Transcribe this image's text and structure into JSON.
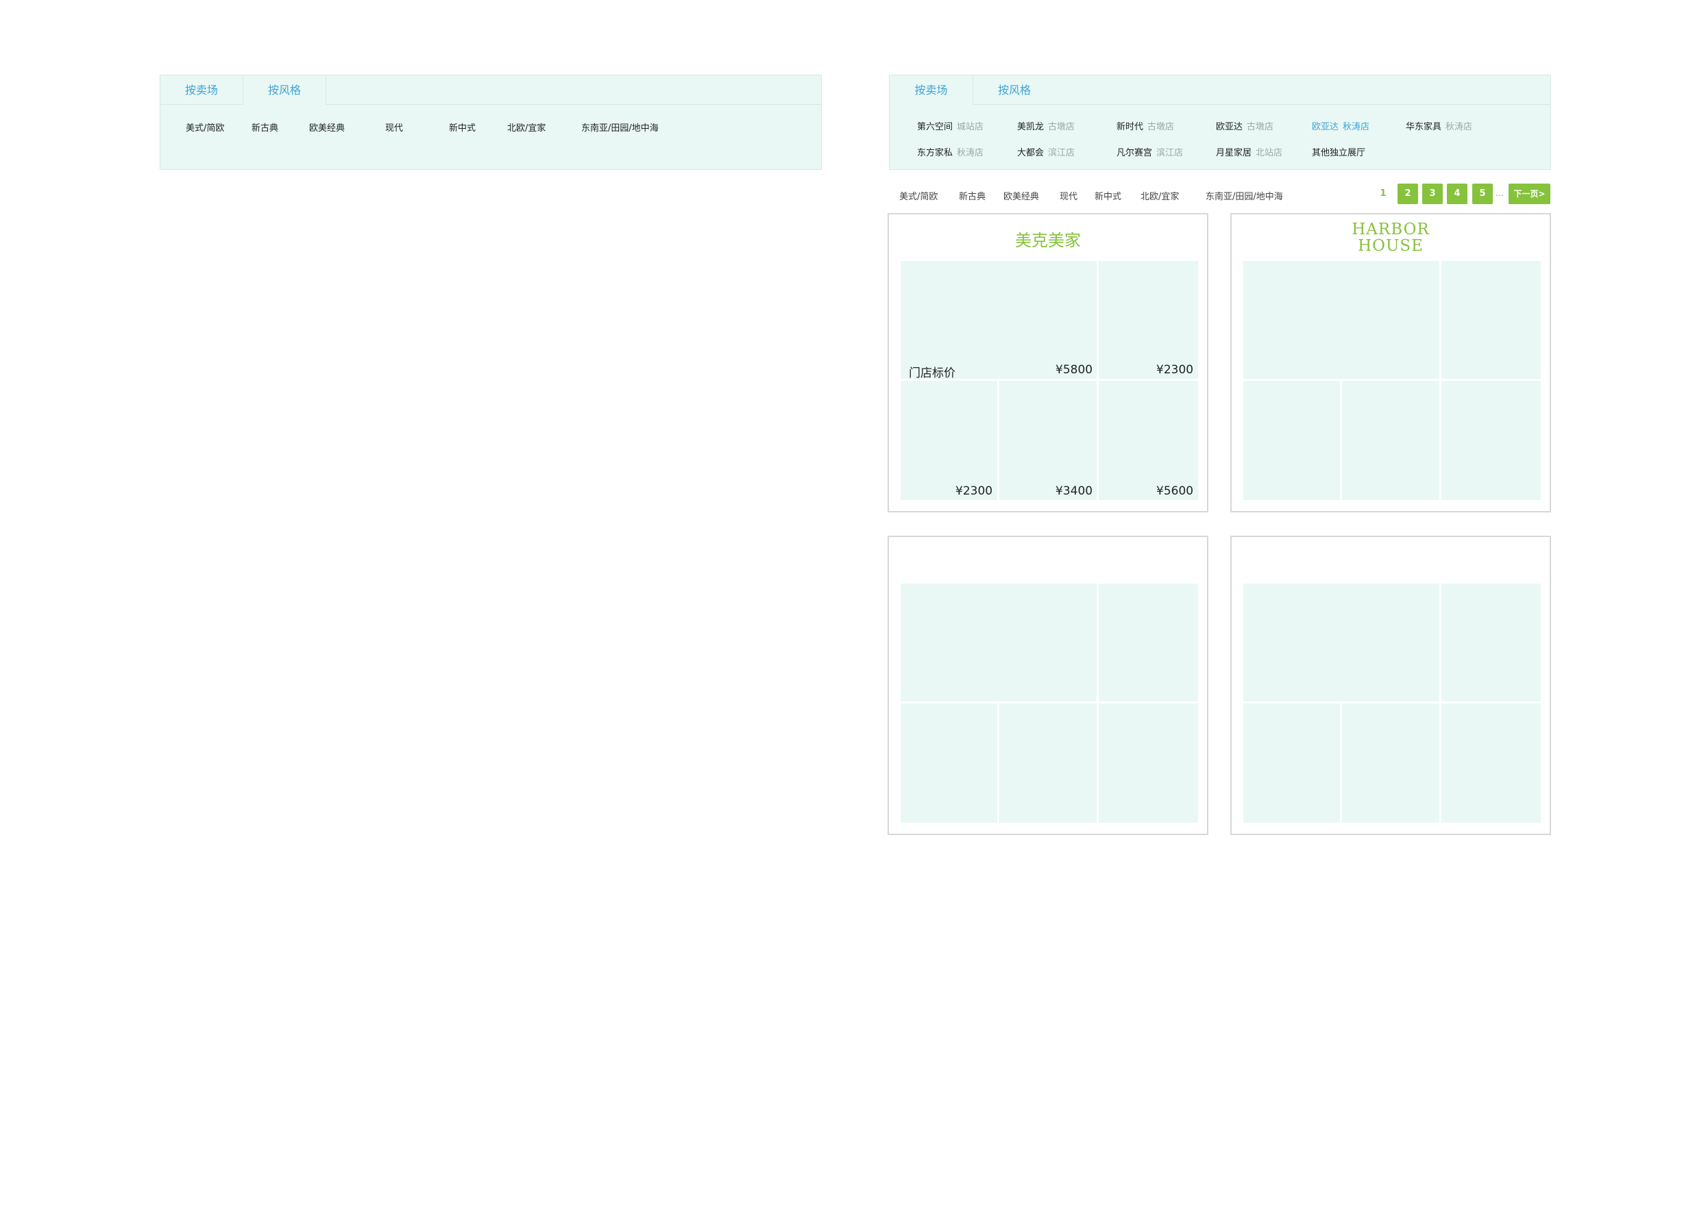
{
  "left_panel": {
    "tabs": [
      "按卖场",
      "按风格"
    ],
    "styles": [
      "美式/简欧",
      "新古典",
      "欧美经典",
      "现代",
      "新中式",
      "北欧/宜家",
      "东南亚/田园/地中海"
    ]
  },
  "right_panel": {
    "tabs": [
      "按卖场",
      "按风格"
    ],
    "stores": [
      {
        "name": "第六空间",
        "loc": "城站店"
      },
      {
        "name": "美凯龙",
        "loc": "古墩店"
      },
      {
        "name": "新时代",
        "loc": "古墩店"
      },
      {
        "name": "欧亚达",
        "loc": "古墩店"
      },
      {
        "name": "欧亚达",
        "loc": "秋涛店"
      },
      {
        "name": "华东家具",
        "loc": "秋涛店"
      },
      {
        "name": "东方家私",
        "loc": "秋涛店"
      },
      {
        "name": "大都会",
        "loc": "滨江店"
      },
      {
        "name": "凡尔赛宫",
        "loc": "滨江店"
      },
      {
        "name": "月星家居",
        "loc": "北站店"
      },
      {
        "name": "其他独立展厅",
        "loc": ""
      }
    ]
  },
  "filter_styles": [
    "美式/简欧",
    "新古典",
    "欧美经典",
    "现代",
    "新中式",
    "北欧/宜家",
    "东南亚/田园/地中海"
  ],
  "pagination": {
    "pages": [
      "1",
      "2",
      "3",
      "4",
      "5"
    ],
    "current": "1",
    "ellipsis": "...",
    "next": "下一页>"
  },
  "cards": [
    {
      "brand": "美克美家",
      "price_label": "门店标价",
      "prices": [
        "¥5800",
        "¥2300",
        "¥2300",
        "¥3400",
        "¥5600"
      ]
    },
    {
      "brand_line1": "HARBOR",
      "brand_line2": "HOUSE"
    }
  ],
  "colors": {
    "accent_green": "#86c23c",
    "tab_blue": "#3fa3d6",
    "panel_bg": "#e9f8f5"
  }
}
